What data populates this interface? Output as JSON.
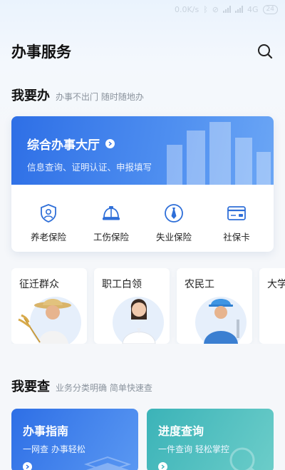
{
  "status_bar": {
    "speed": "0.0K/s",
    "network": "4G",
    "battery": "24"
  },
  "header": {
    "title": "办事服务",
    "search_icon": "search-icon"
  },
  "section_do": {
    "title": "我要办",
    "subtitle": "办事不出门 随时随地办"
  },
  "hall": {
    "title": "综合办事大厅",
    "subtitle": "信息查询、证明认证、申报填写",
    "services": [
      {
        "label": "养老保险",
        "icon": "pension-icon"
      },
      {
        "label": "工伤保险",
        "icon": "helmet-icon"
      },
      {
        "label": "失业保险",
        "icon": "tie-icon"
      },
      {
        "label": "社保卡",
        "icon": "card-icon"
      }
    ]
  },
  "categories": [
    {
      "label": "征迁群众"
    },
    {
      "label": "职工白领"
    },
    {
      "label": "农民工"
    },
    {
      "label": "大学"
    }
  ],
  "section_query": {
    "title": "我要查",
    "subtitle": "业务分类明确 简单快速查"
  },
  "query_cards": [
    {
      "title": "办事指南",
      "subtitle": "一网查 办事轻松"
    },
    {
      "title": "进度查询",
      "subtitle": "一件查询 轻松掌控"
    }
  ],
  "colors": {
    "primary_blue": "#2e6fe6",
    "teal": "#3bb3b8",
    "icon_blue": "#2f6fd8"
  }
}
